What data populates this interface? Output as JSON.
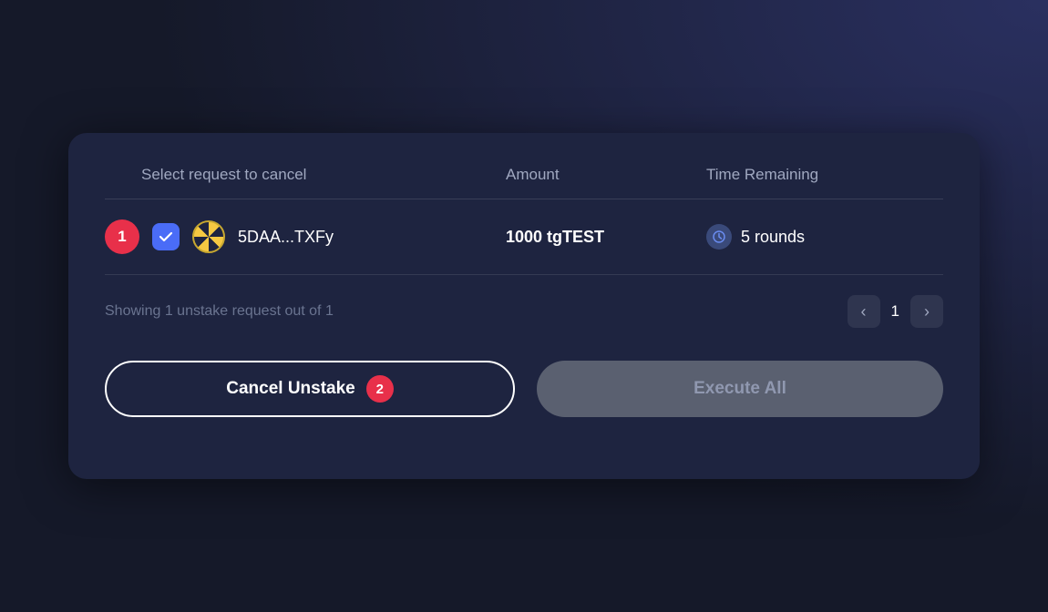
{
  "modal": {
    "table": {
      "headers": {
        "select": "Select request to cancel",
        "amount": "Amount",
        "timeRemaining": "Time Remaining"
      },
      "rows": [
        {
          "index": 1,
          "address": "5DAA...TXFy",
          "amount": "1000 tgTEST",
          "timeRemaining": "5 rounds",
          "checked": true
        }
      ]
    },
    "pagination": {
      "info": "Showing 1 unstake request out of 1",
      "currentPage": "1"
    },
    "actions": {
      "cancelUnstake": "Cancel Unstake",
      "cancelBadge": "2",
      "executeAll": "Execute All"
    }
  }
}
